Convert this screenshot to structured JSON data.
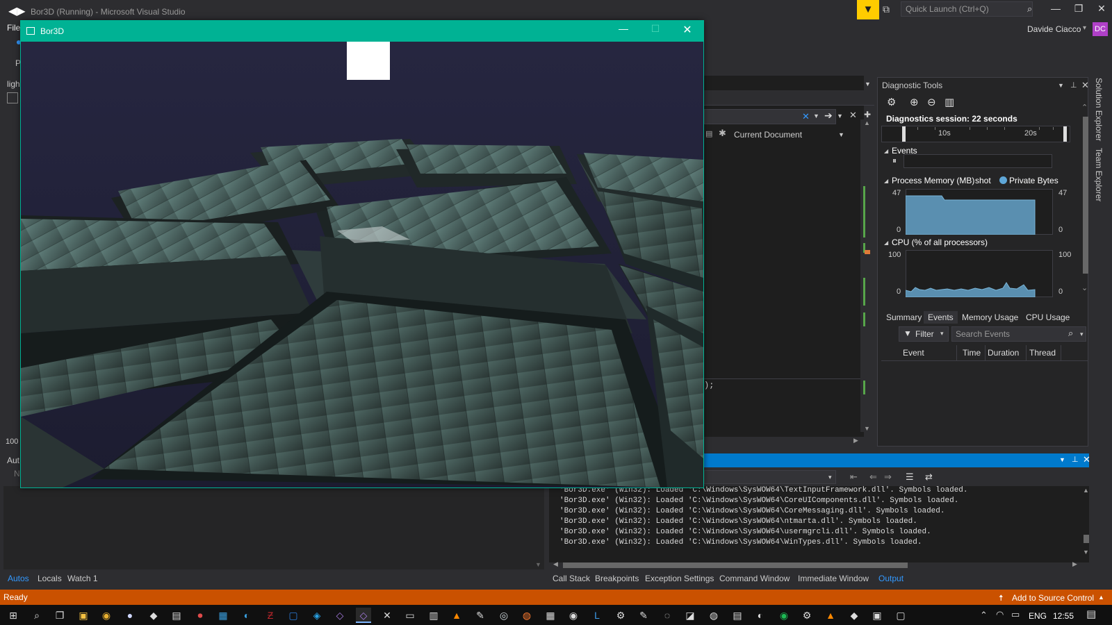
{
  "vs": {
    "title": "Bor3D (Running) - Microsoft Visual Studio",
    "quick_launch_placeholder": "Quick Launch (Ctrl+Q)",
    "user_name": "Davide Ciacco",
    "user_initials": "DC",
    "menu_file": "File",
    "left_fragments": {
      "p": "P",
      "ligh": "ligh",
      "zoom": "100",
      "aut": "Aut",
      "n": "N"
    }
  },
  "editor": {
    "scope_label": "Current Document",
    "code_snippet": ");"
  },
  "diagnostics": {
    "title": "Diagnostic Tools",
    "session": "Diagnostics session: 22 seconds",
    "timeline_labels": [
      "10s",
      "20s"
    ],
    "events_label": "Events",
    "memory_label": "Process Memory (MB)",
    "memory_snapshot": "shot",
    "memory_legend": "Private Bytes",
    "memory_max": "47",
    "memory_min": "0",
    "cpu_label": "CPU (% of all processors)",
    "cpu_max": "100",
    "cpu_min": "0",
    "tabs": [
      "Summary",
      "Events",
      "Memory Usage",
      "CPU Usage"
    ],
    "filter_label": "Filter",
    "search_placeholder": "Search Events",
    "columns": [
      "Event",
      "Time",
      "Duration",
      "Thread"
    ]
  },
  "right_rail": [
    "Solution Explorer",
    "Team Explorer"
  ],
  "output": {
    "lines": [
      "'Bor3D.exe' (Win32): Loaded 'C:\\Windows\\SysWOW64\\TextInputFramework.dll'. Symbols loaded.",
      "'Bor3D.exe' (Win32): Loaded 'C:\\Windows\\SysWOW64\\CoreUIComponents.dll'. Symbols loaded.",
      "'Bor3D.exe' (Win32): Loaded 'C:\\Windows\\SysWOW64\\CoreMessaging.dll'. Symbols loaded.",
      "'Bor3D.exe' (Win32): Loaded 'C:\\Windows\\SysWOW64\\ntmarta.dll'. Symbols loaded.",
      "'Bor3D.exe' (Win32): Loaded 'C:\\Windows\\SysWOW64\\usermgrcli.dll'. Symbols loaded.",
      "'Bor3D.exe' (Win32): Loaded 'C:\\Windows\\SysWOW64\\WinTypes.dll'. Symbols loaded."
    ]
  },
  "bottom_tabs_left": [
    "Autos",
    "Locals",
    "Watch 1"
  ],
  "bottom_tabs_right": [
    "Call Stack",
    "Breakpoints",
    "Exception Settings",
    "Command Window",
    "Immediate Window",
    "Output"
  ],
  "status": {
    "text": "Ready",
    "source_control": "Add to Source Control"
  },
  "taskbar": {
    "lang": "ENG",
    "time": "12:55",
    "apps": [
      "start",
      "search",
      "task-view",
      "file-explorer",
      "chrome",
      "obs",
      "unity",
      "notepad",
      "record",
      "paint",
      "edge",
      "filezilla",
      "terminal",
      "vscode",
      "vs",
      "vs-active",
      "app",
      "cmd",
      "app2",
      "vlc",
      "app3",
      "steam",
      "firefox",
      "app4",
      "app5",
      "lr",
      "app6",
      "app7",
      "app8",
      "app9",
      "app10",
      "app11",
      "app12",
      "spotify",
      "app13",
      "vlc2",
      "app14",
      "app15",
      "app16"
    ]
  },
  "game": {
    "title": "Bor3D"
  },
  "colors": {
    "accent_vs": "#007acc",
    "status_bar": "#ca5100",
    "game_titlebar": "#00b294",
    "filter_badge": "#ffcc00"
  }
}
